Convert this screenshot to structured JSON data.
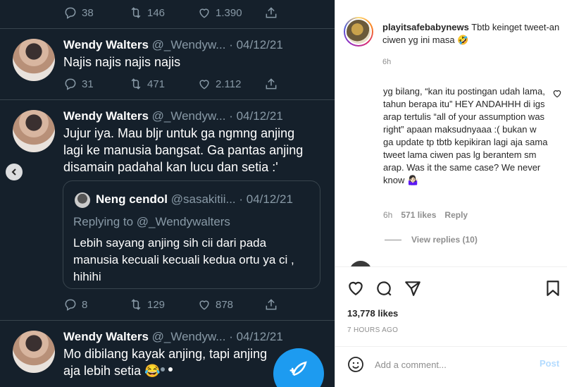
{
  "tweets": [
    {
      "actions": {
        "reply": "38",
        "retweet": "146",
        "like": "1.390"
      }
    },
    {
      "name": "Wendy Walters",
      "handle": "@_Wendyw...",
      "date": "· 04/12/21",
      "text": "Najis najis najis najis",
      "actions": {
        "reply": "31",
        "retweet": "471",
        "like": "2.112"
      }
    },
    {
      "name": "Wendy Walters",
      "handle": "@_Wendyw...",
      "date": "· 04/12/21",
      "text": "Jujur iya. Mau bljr untuk ga ngmng anjing lagi ke manusia bangsat. Ga pantas anjing disamain padahal kan lucu dan setia :'",
      "quote": {
        "name": "Neng cendol",
        "handle": "@sasakitii...",
        "date": "· 04/12/21",
        "replying": "Replying to @_Wendywalters",
        "text": "Lebih sayang anjing sih cii dari pada manusia kecuali kecuali kedua ortu ya ci , hihihi"
      },
      "actions": {
        "reply": "8",
        "retweet": "129",
        "like": "878"
      }
    },
    {
      "name": "Wendy Walters",
      "handle": "@_Wendyw...",
      "date": "· 04/12/21",
      "text": "Mo dibilang kayak anjing, tapi anjing aja lebih setia 😂"
    }
  ],
  "instagram": {
    "caption": {
      "username": "playitsafebabynews",
      "text": "Tbtb keinget tweet-an ciwen yg ini masa 🤣",
      "time": "6h"
    },
    "comment": {
      "text": "yg bilang, “kan itu postingan udah lama, tahun berapa itu” HEY ANDAHHH di igs arap tertulis “all of your assumption was right” apaan maksudnyaaa :( bukan w ga update tp tbtb kepikiran lagi aja sama tweet lama ciwen pas lg berantem sm arap. Was it the same case? We never know 🤷🏻‍♀️",
      "time": "6h",
      "likes": "571 likes",
      "reply": "Reply",
      "view_replies": "View replies (10)"
    },
    "likes": "13,778 likes",
    "post_time": "7 HOURS AGO",
    "comment_placeholder": "Add a comment...",
    "post_button": "Post"
  },
  "colors": {
    "twitter_bg": "#15202b",
    "twitter_border": "#38444d",
    "twitter_muted": "#8899a6",
    "twitter_blue": "#1d9bf0",
    "ig_muted": "#8e8e8e",
    "ig_post_disabled": "#b3dbff"
  },
  "icons": [
    "reply-icon",
    "retweet-icon",
    "like-icon",
    "share-icon",
    "chevron-left-icon",
    "compose-tweet-icon",
    "heart-icon",
    "comment-icon",
    "send-icon",
    "bookmark-icon",
    "emoji-icon"
  ]
}
